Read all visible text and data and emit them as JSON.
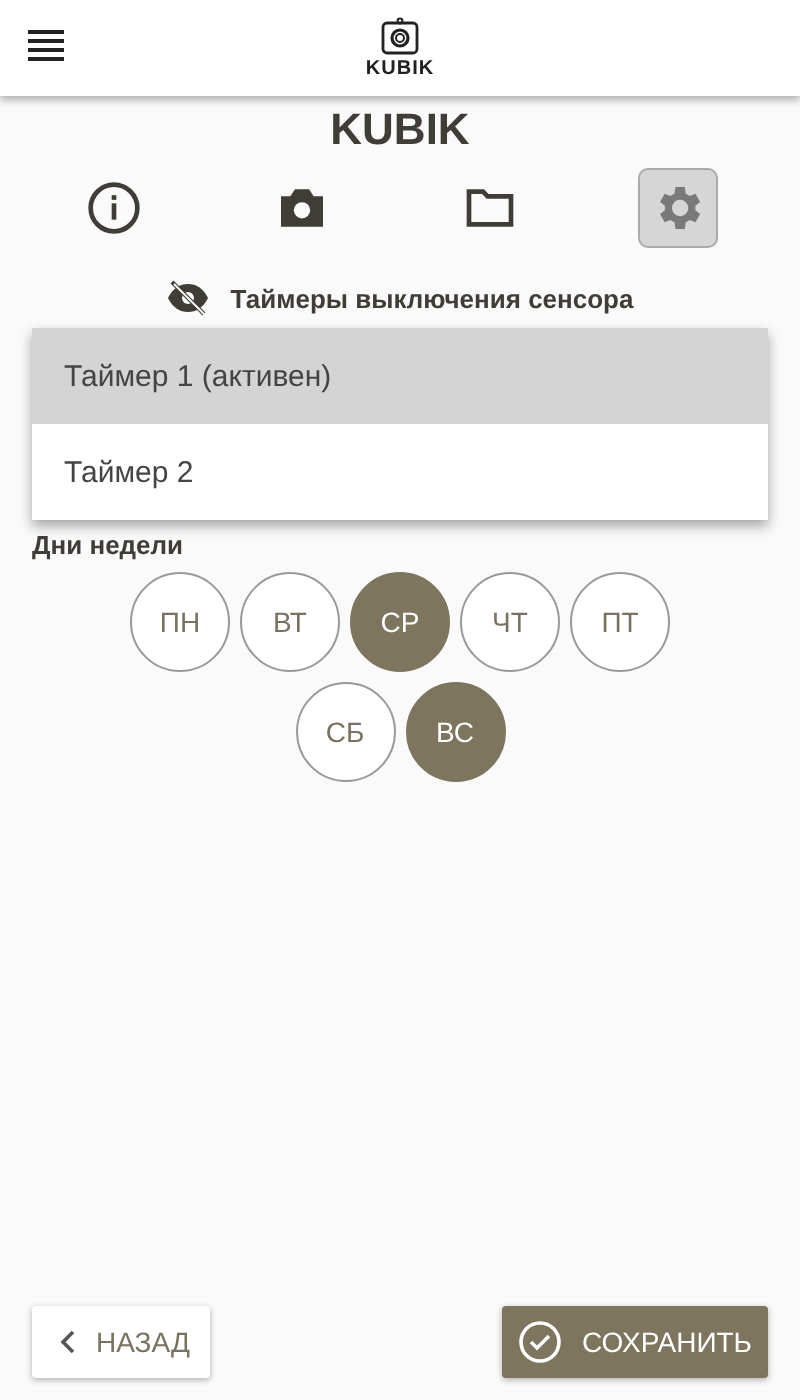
{
  "header": {
    "logo_text": "KUBIK"
  },
  "title": "KUBIK",
  "nav_tabs": [
    {
      "kind": "info",
      "selected": false
    },
    {
      "kind": "camera",
      "selected": false
    },
    {
      "kind": "folder",
      "selected": false
    },
    {
      "kind": "settings",
      "selected": true
    }
  ],
  "section": {
    "title": "Таймеры выключения сенсора"
  },
  "timer_menu": [
    {
      "label": "Таймер 1 (активен)",
      "selected": true
    },
    {
      "label": "Таймер 2",
      "selected": false
    }
  ],
  "weekdays": {
    "label": "Дни недели",
    "rows": [
      [
        {
          "label": "ПН",
          "selected": false
        },
        {
          "label": "ВТ",
          "selected": false
        },
        {
          "label": "СР",
          "selected": true
        },
        {
          "label": "ЧТ",
          "selected": false
        },
        {
          "label": "ПТ",
          "selected": false
        }
      ],
      [
        {
          "label": "СБ",
          "selected": false
        },
        {
          "label": "ВС",
          "selected": true
        }
      ]
    ]
  },
  "buttons": {
    "back": "НАЗАД",
    "save": "СОХРАНИТЬ"
  }
}
